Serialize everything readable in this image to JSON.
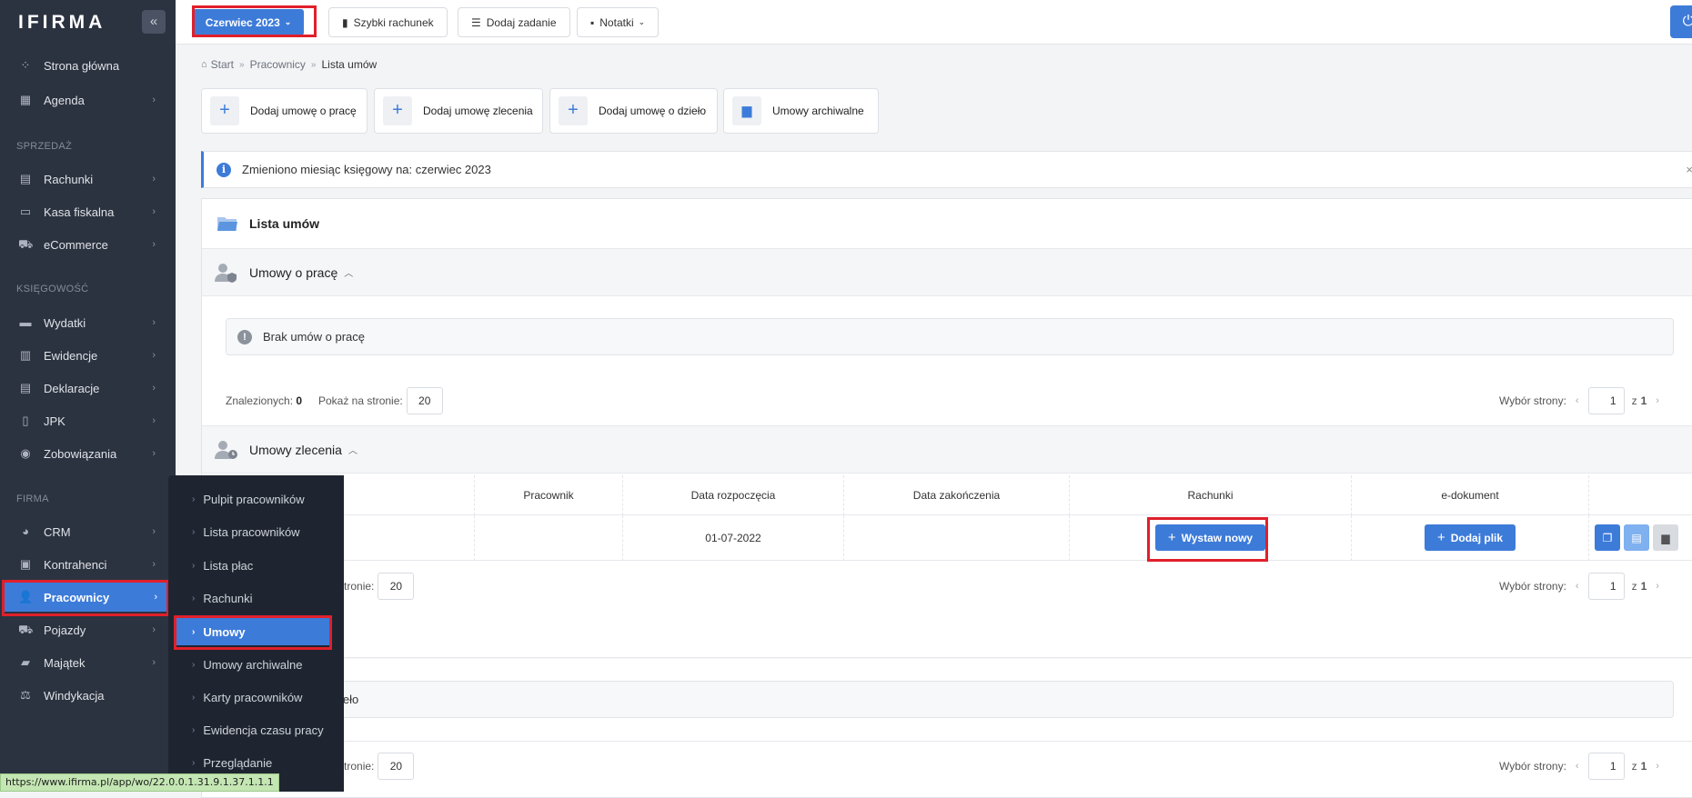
{
  "app": {
    "logo": "IFIRMA",
    "collapse_icon": "chevron-double-left-icon"
  },
  "sidebar": {
    "top_items": [
      {
        "label": "Strona główna",
        "icon": "dashboard-icon"
      },
      {
        "label": "Agenda",
        "icon": "calendar-icon"
      }
    ],
    "sections": {
      "sales": "SPRZEDAŻ",
      "accounting": "KSIĘGOWOŚĆ",
      "company": "FIRMA"
    },
    "sales_items": [
      {
        "label": "Rachunki",
        "icon": "document-icon"
      },
      {
        "label": "Kasa fiskalna",
        "icon": "cash-register-icon"
      },
      {
        "label": "eCommerce",
        "icon": "cart-icon"
      }
    ],
    "accounting_items": [
      {
        "label": "Wydatki",
        "icon": "money-icon"
      },
      {
        "label": "Ewidencje",
        "icon": "clipboard-icon"
      },
      {
        "label": "Deklaracje",
        "icon": "form-icon"
      },
      {
        "label": "JPK",
        "icon": "file-icon"
      },
      {
        "label": "Zobowiązania",
        "icon": "coins-icon"
      }
    ],
    "company_items": [
      {
        "label": "CRM",
        "icon": "pie-icon"
      },
      {
        "label": "Kontrahenci",
        "icon": "contacts-icon"
      },
      {
        "label": "Pracownicy",
        "icon": "users-icon"
      },
      {
        "label": "Pojazdy",
        "icon": "truck-icon"
      },
      {
        "label": "Majątek",
        "icon": "car-icon"
      },
      {
        "label": "Windykacja",
        "icon": "scale-icon"
      }
    ]
  },
  "submenu": {
    "items": [
      "Pulpit pracowników",
      "Lista pracowników",
      "Lista płac",
      "Rachunki",
      "Umowy",
      "Umowy archiwalne",
      "Karty pracowników",
      "Ewidencja czasu pracy",
      "Przeglądanie"
    ],
    "active": "Umowy"
  },
  "topbar": {
    "month": "Czerwiec 2023",
    "quick_invoice": "Szybki rachunek",
    "add_task": "Dodaj zadanie",
    "notes": "Notatki"
  },
  "breadcrumb": [
    "Start",
    "Pracownicy",
    "Lista umów"
  ],
  "actions": [
    "Dodaj umowę o pracę",
    "Dodaj umowę zlecenia",
    "Dodaj umowę o dzieło",
    "Umowy archiwalne"
  ],
  "alert": {
    "text": "Zmieniono miesiąc księgowy na: czerwiec 2023",
    "close": "×"
  },
  "panel": {
    "title": "Lista umów"
  },
  "employment": {
    "title": "Umowy o pracę",
    "empty": "Brak umów o pracę",
    "found_label": "Znalezionych:",
    "found_count": "0",
    "per_page_label": "Pokaż na stronie:",
    "per_page": "20",
    "page_label": "Wybór strony:",
    "page": "1",
    "of": "z",
    "total": "1"
  },
  "commission": {
    "title": "Umowy zlecenia",
    "columns": [
      "Pracownik",
      "Data rozpoczęcia",
      "Data zakończenia",
      "Rachunki",
      "e-dokument"
    ],
    "row": {
      "start_date": "01-07-2022",
      "issue_btn": "Wystaw nowy",
      "add_file_btn": "Dodaj plik"
    },
    "per_page_label": "ż na stronie:",
    "per_page": "20",
    "page_label": "Wybór strony:",
    "page": "1",
    "of": "z",
    "total": "1"
  },
  "work": {
    "empty_partial": "ieło",
    "per_page_label": "ż na stronie:",
    "per_page": "20",
    "page_label": "Wybór strony:",
    "page": "1",
    "of": "z",
    "total": "1"
  },
  "status_url": "https://www.ifirma.pl/app/wo/22.0.0.1.31.9.1.37.1.1.1"
}
